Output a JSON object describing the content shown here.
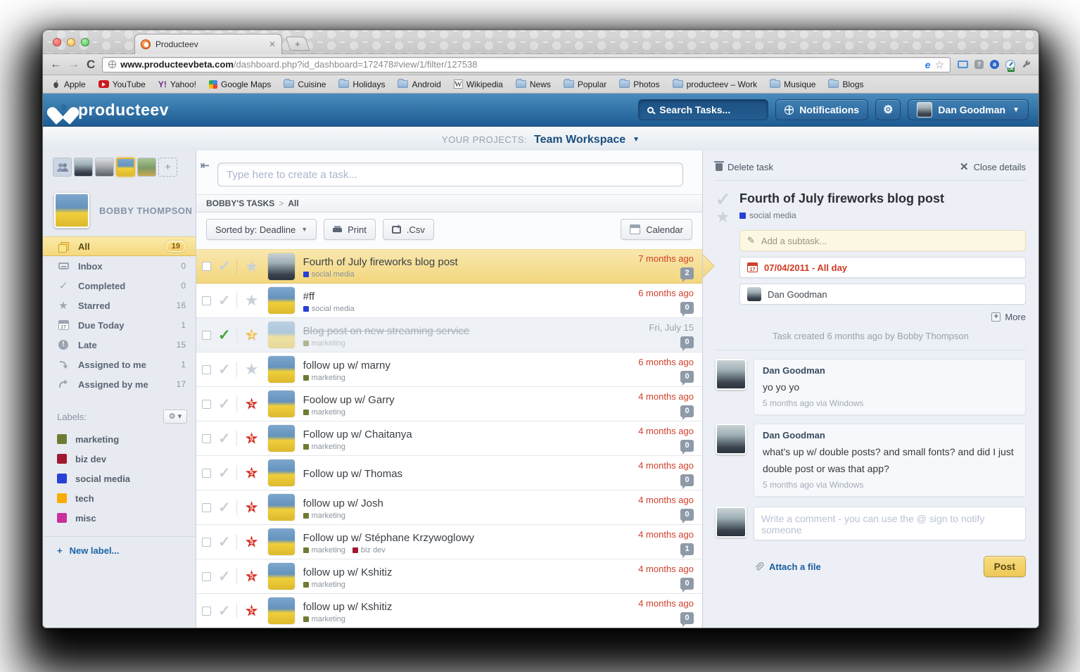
{
  "colors": {
    "header_blue": "#2a6399",
    "selection_yellow": "#f5d87d",
    "alert_red": "#d0402b"
  },
  "browser": {
    "tab_title": "Producteev",
    "url_domain": "www.producteevbeta.com",
    "url_path": "/dashboard.php?id_dashboard=172478#view/1/filter/127538",
    "bookmarks": [
      {
        "label": "Apple",
        "icon": "apple"
      },
      {
        "label": "YouTube",
        "icon": "youtube"
      },
      {
        "label": "Yahoo!",
        "icon": "yahoo"
      },
      {
        "label": "Google Maps",
        "icon": "maps"
      },
      {
        "label": "Cuisine",
        "icon": "folder"
      },
      {
        "label": "Holidays",
        "icon": "folder"
      },
      {
        "label": "Android",
        "icon": "folder"
      },
      {
        "label": "Wikipedia",
        "icon": "wiki"
      },
      {
        "label": "News",
        "icon": "folder"
      },
      {
        "label": "Popular",
        "icon": "folder"
      },
      {
        "label": "Photos",
        "icon": "folder"
      },
      {
        "label": "producteev – Work",
        "icon": "folder"
      },
      {
        "label": "Musique",
        "icon": "folder"
      },
      {
        "label": "Blogs",
        "icon": "folder"
      }
    ]
  },
  "app_header": {
    "logo": "producteev",
    "search_placeholder": "Search Tasks...",
    "notifications_label": "Notifications",
    "user_name": "Dan Goodman"
  },
  "projects_bar": {
    "label": "YOUR PROJECTS:",
    "project": "Team Workspace"
  },
  "sidebar": {
    "user_name": "BOBBY THOMPSON",
    "filters": [
      {
        "icon": "all",
        "label": "All",
        "count": "19",
        "selected": true
      },
      {
        "icon": "inbox",
        "label": "Inbox",
        "count": "0",
        "selected": false
      },
      {
        "icon": "check",
        "label": "Completed",
        "count": "0",
        "selected": false
      },
      {
        "icon": "star",
        "label": "Starred",
        "count": "16",
        "selected": false
      },
      {
        "icon": "caltoday",
        "label": "Due Today",
        "count": "1",
        "selected": false
      },
      {
        "icon": "late",
        "label": "Late",
        "count": "15",
        "selected": false
      },
      {
        "icon": "tome",
        "label": "Assigned to me",
        "count": "1",
        "selected": false
      },
      {
        "icon": "byme",
        "label": "Assigned by me",
        "count": "17",
        "selected": false
      }
    ],
    "labels_title": "Labels:",
    "labels": [
      {
        "name": "marketing",
        "color": "#6e7c33"
      },
      {
        "name": "biz dev",
        "color": "#a01931"
      },
      {
        "name": "social media",
        "color": "#2741d6"
      },
      {
        "name": "tech",
        "color": "#fbab00"
      },
      {
        "name": "misc",
        "color": "#c9309b"
      }
    ],
    "new_label": "New label..."
  },
  "main": {
    "create_placeholder": "Type here to create a task...",
    "breadcrumb_root": "BOBBY'S TASKS",
    "breadcrumb_sep": ">",
    "breadcrumb_current": "All",
    "toolbar": {
      "sorted_by": "Sorted by: Deadline",
      "print": "Print",
      "csv": ".Csv",
      "calendar": "Calendar"
    },
    "tasks": [
      {
        "title": "Fourth of July fireworks blog post",
        "labels": [
          "social media"
        ],
        "time": "7 months ago",
        "comments": "2",
        "star": "gray",
        "star_num": "",
        "check": "gray",
        "avatar": "dan",
        "selected": true,
        "completed": false
      },
      {
        "title": "#ff",
        "labels": [
          "social media"
        ],
        "time": "6 months ago",
        "comments": "0",
        "star": "gray",
        "star_num": "",
        "check": "gray",
        "avatar": "bobby",
        "selected": false,
        "completed": false
      },
      {
        "title": "Blog post on new streaming service",
        "labels": [
          "marketing"
        ],
        "time": "Fri, July 15",
        "comments": "0",
        "star": "orange",
        "star_num": "3",
        "check": "green",
        "avatar": "bobby",
        "selected": false,
        "completed": true
      },
      {
        "title": "follow up w/ marny",
        "labels": [
          "marketing"
        ],
        "time": "6 months ago",
        "comments": "0",
        "star": "gray",
        "star_num": "",
        "check": "gray",
        "avatar": "bobby",
        "selected": false,
        "completed": false
      },
      {
        "title": "Foolow up w/ Garry",
        "labels": [
          "marketing"
        ],
        "time": "4 months ago",
        "comments": "0",
        "star": "red",
        "star_num": "5",
        "check": "gray",
        "avatar": "bobby",
        "selected": false,
        "completed": false
      },
      {
        "title": "Follow up w/ Chaitanya",
        "labels": [
          "marketing"
        ],
        "time": "4 months ago",
        "comments": "0",
        "star": "red",
        "star_num": "5",
        "check": "gray",
        "avatar": "bobby",
        "selected": false,
        "completed": false
      },
      {
        "title": "Follow up w/ Thomas",
        "labels": [],
        "time": "4 months ago",
        "comments": "0",
        "star": "red",
        "star_num": "5",
        "check": "gray",
        "avatar": "bobby",
        "selected": false,
        "completed": false
      },
      {
        "title": "follow up w/ Josh",
        "labels": [
          "marketing"
        ],
        "time": "4 months ago",
        "comments": "0",
        "star": "red",
        "star_num": "5",
        "check": "gray",
        "avatar": "bobby",
        "selected": false,
        "completed": false
      },
      {
        "title": "Follow up w/ Stéphane Krzywoglowy",
        "labels": [
          "marketing",
          "biz dev"
        ],
        "time": "4 months ago",
        "comments": "1",
        "star": "red",
        "star_num": "5",
        "check": "gray",
        "avatar": "bobby",
        "selected": false,
        "completed": false
      },
      {
        "title": "follow up w/ Kshitiz",
        "labels": [
          "marketing"
        ],
        "time": "4 months ago",
        "comments": "0",
        "star": "red",
        "star_num": "5",
        "check": "gray",
        "avatar": "bobby",
        "selected": false,
        "completed": false
      },
      {
        "title": "follow up w/ Kshitiz",
        "labels": [
          "marketing"
        ],
        "time": "4 months ago",
        "comments": "0",
        "star": "red",
        "star_num": "5",
        "check": "gray",
        "avatar": "bobby",
        "selected": false,
        "completed": false
      }
    ]
  },
  "details": {
    "delete_label": "Delete task",
    "close_label": "Close details",
    "title": "Fourth of July fireworks blog post",
    "label": "social media",
    "subtask_placeholder": "Add a subtask...",
    "due": "07/04/2011 - All day",
    "assignee": "Dan Goodman",
    "more_label": "More",
    "created_note": "Task created 6 months ago by Bobby Thompson",
    "comments": [
      {
        "author": "Dan Goodman",
        "text": "yo yo yo",
        "meta": "5 months ago via Windows"
      },
      {
        "author": "Dan Goodman",
        "text": "what's up w/ double posts? and small fonts? and did I just double post or was that app?",
        "meta": "5 months ago via Windows"
      }
    ],
    "comment_placeholder": "Write a comment - you can use the @ sign to notify someone",
    "attach_label": "Attach a file",
    "post_label": "Post"
  }
}
